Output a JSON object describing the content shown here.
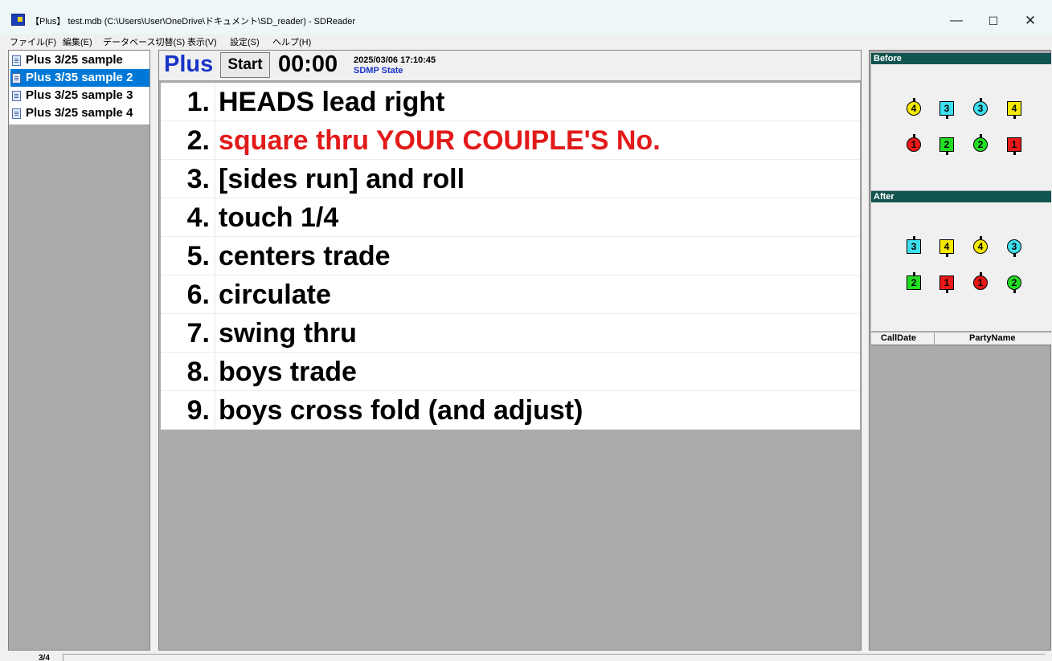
{
  "window": {
    "title": "【Plus】 test.mdb (C:\\Users\\User\\OneDrive\\ドキュメント\\SD_reader) - SDReader",
    "minimize": "—",
    "maximize": "☐",
    "close": "✕"
  },
  "menu": [
    {
      "label": "ファイル(F)"
    },
    {
      "label": "編集(E)"
    },
    {
      "label": "データベース切替(S)"
    },
    {
      "label": "表示(V)"
    },
    {
      "label": "設定(S)"
    },
    {
      "label": "ヘルプ(H)"
    }
  ],
  "sequences": [
    {
      "label": "Plus 3/25 sample",
      "selected": false
    },
    {
      "label": "Plus 3/35 sample 2",
      "selected": true
    },
    {
      "label": "Plus 3/25 sample 3",
      "selected": false
    },
    {
      "label": "Plus 3/25 sample 4",
      "selected": false
    }
  ],
  "header": {
    "level": "Plus",
    "start_label": "Start",
    "timer": "00:00",
    "datetime": "2025/03/06 17:10:45",
    "state_label": "SDMP State"
  },
  "calls": [
    {
      "num": "1.",
      "text": "HEADS lead right",
      "color": "#000000"
    },
    {
      "num": "2.",
      "text": "square thru YOUR COUIPLE'S No.",
      "color": "#e21a1a"
    },
    {
      "num": "3.",
      "text": "[sides run] and roll",
      "color": "#000000"
    },
    {
      "num": "4.",
      "text": "touch 1/4",
      "color": "#000000"
    },
    {
      "num": "5.",
      "text": "centers trade",
      "color": "#000000"
    },
    {
      "num": "6.",
      "text": "circulate",
      "color": "#000000"
    },
    {
      "num": "7.",
      "text": "swing thru",
      "color": "#000000"
    },
    {
      "num": "8.",
      "text": "boys trade",
      "color": "#000000"
    },
    {
      "num": "9.",
      "text": "boys cross fold (and adjust)",
      "color": "#000000"
    }
  ],
  "before": {
    "label": "Before",
    "rows": [
      [
        {
          "n": "4",
          "shape": "circle",
          "color": "#f5ea00",
          "facing": "up"
        },
        {
          "n": "3",
          "shape": "square",
          "color": "#3ee0ee",
          "facing": "down"
        },
        {
          "n": "3",
          "shape": "circle",
          "color": "#3ee0ee",
          "facing": "up"
        },
        {
          "n": "4",
          "shape": "square",
          "color": "#f5ea00",
          "facing": "down"
        }
      ],
      [
        {
          "n": "1",
          "shape": "circle",
          "color": "#e81818",
          "facing": "up"
        },
        {
          "n": "2",
          "shape": "square",
          "color": "#22dd22",
          "facing": "down"
        },
        {
          "n": "2",
          "shape": "circle",
          "color": "#22dd22",
          "facing": "up"
        },
        {
          "n": "1",
          "shape": "square",
          "color": "#e81818",
          "facing": "down"
        }
      ]
    ]
  },
  "after": {
    "label": "After",
    "rows": [
      [
        {
          "n": "3",
          "shape": "square",
          "color": "#3ee0ee",
          "facing": "up"
        },
        {
          "n": "4",
          "shape": "square",
          "color": "#f5ea00",
          "facing": "down"
        },
        {
          "n": "4",
          "shape": "circle",
          "color": "#f5ea00",
          "facing": "up"
        },
        {
          "n": "3",
          "shape": "circle",
          "color": "#3ee0ee",
          "facing": "down"
        }
      ],
      [
        {
          "n": "2",
          "shape": "square",
          "color": "#22dd22",
          "facing": "up"
        },
        {
          "n": "1",
          "shape": "square",
          "color": "#e81818",
          "facing": "down"
        },
        {
          "n": "1",
          "shape": "circle",
          "color": "#e81818",
          "facing": "up"
        },
        {
          "n": "2",
          "shape": "circle",
          "color": "#22dd22",
          "facing": "down"
        }
      ]
    ]
  },
  "history": {
    "col1": "CallDate",
    "col2": "PartyName"
  },
  "status": {
    "count": "3/4"
  }
}
